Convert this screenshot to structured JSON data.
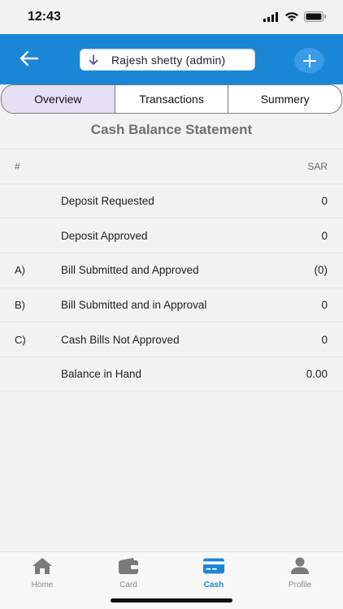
{
  "status": {
    "time": "12:43"
  },
  "header": {
    "user_name": "Rajesh shetty (admin)",
    "accent_color": "#1a86d6"
  },
  "tabs": [
    {
      "label": "Overview",
      "active": true
    },
    {
      "label": "Transactions",
      "active": false
    },
    {
      "label": "Summery",
      "active": false
    }
  ],
  "statement": {
    "title": "Cash Balance Statement",
    "columns": {
      "index": "#",
      "currency": "SAR"
    },
    "rows": [
      {
        "index": "",
        "label": "Deposit Requested",
        "value": "0"
      },
      {
        "index": "",
        "label": "Deposit Approved",
        "value": "0"
      },
      {
        "index": "A)",
        "label": "Bill Submitted and Approved",
        "value": "(0)"
      },
      {
        "index": "B)",
        "label": "Bill Submitted and in Approval",
        "value": "0"
      },
      {
        "index": "C)",
        "label": "Cash Bills Not Approved",
        "value": "0"
      },
      {
        "index": "",
        "label": "Balance in Hand",
        "value": "0.00"
      }
    ]
  },
  "bottom_nav": [
    {
      "label": "Home",
      "icon": "home-icon",
      "active": false
    },
    {
      "label": "Card",
      "icon": "wallet-icon",
      "active": false
    },
    {
      "label": "Cash",
      "icon": "card-icon",
      "active": true
    },
    {
      "label": "Profile",
      "icon": "person-icon",
      "active": false
    }
  ]
}
